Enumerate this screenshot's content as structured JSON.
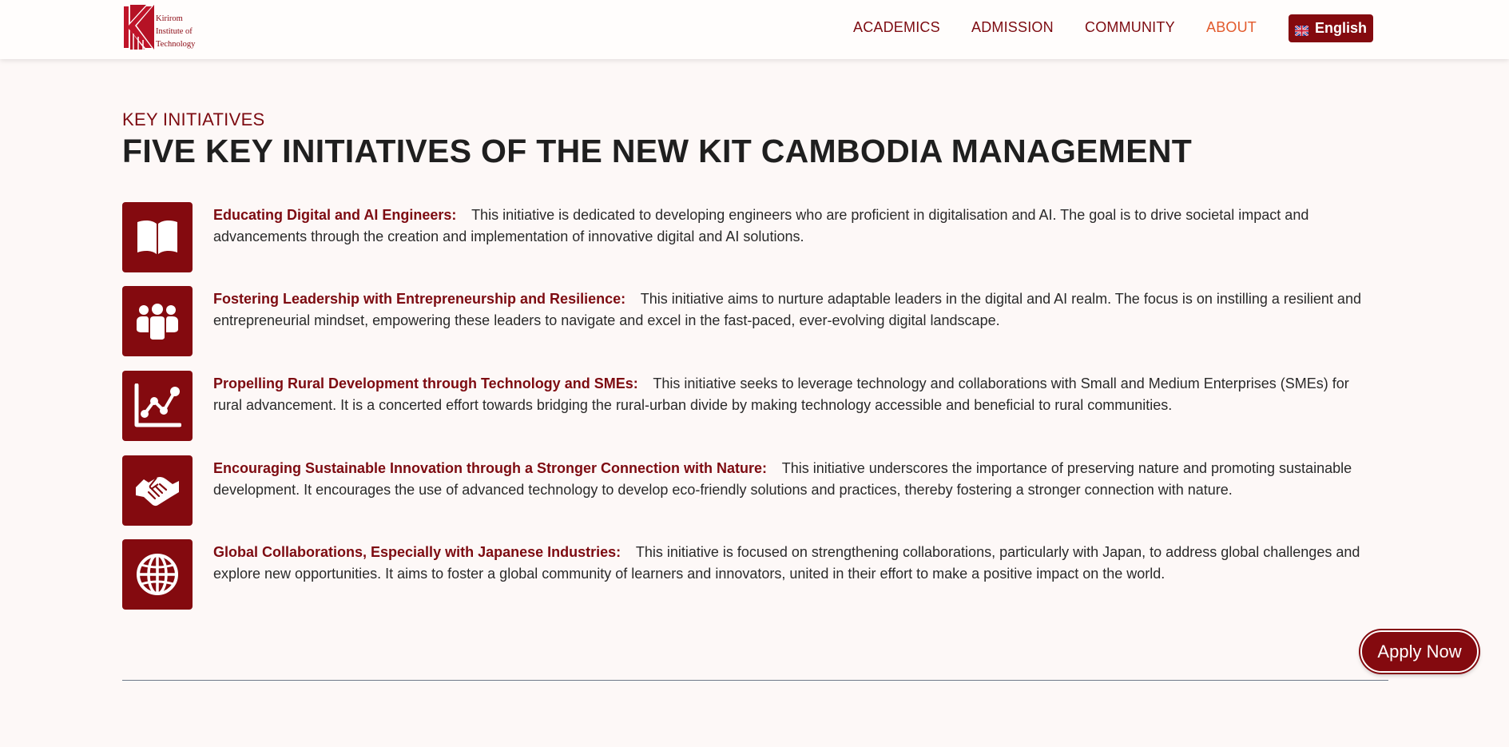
{
  "header": {
    "logo_text_lines": [
      "Kirirom",
      "Institute of",
      "Technology"
    ],
    "nav": [
      {
        "label": "ACADEMICS",
        "active": false
      },
      {
        "label": "ADMISSION",
        "active": false
      },
      {
        "label": "COMMUNITY",
        "active": false
      },
      {
        "label": "ABOUT",
        "active": true
      }
    ],
    "language_button": "English",
    "language_icon": "uk-flag-icon"
  },
  "section": {
    "kicker": "KEY INITIATIVES",
    "title": "FIVE KEY INITIATIVES OF THE NEW KIT CAMBODIA MANAGEMENT"
  },
  "initiatives": [
    {
      "icon": "book-icon",
      "title": "Educating Digital and AI Engineers:",
      "text": "This initiative is dedicated to developing engineers who are proficient in digitalisation and AI. The goal is to drive societal impact and advancements through the creation and implementation of innovative digital and AI solutions."
    },
    {
      "icon": "group-icon",
      "title": "Fostering Leadership with Entrepreneurship and Resilience:",
      "text": "This initiative aims to nurture adaptable leaders in the digital and AI realm. The focus is on instilling a resilient and entrepreneurial mindset, empowering these leaders to navigate and excel in the fast-paced, ever-evolving digital landscape."
    },
    {
      "icon": "line-chart-icon",
      "title": "Propelling Rural Development through Technology and SMEs:",
      "text": "This initiative seeks to leverage technology and collaborations with Small and Medium Enterprises (SMEs) for rural advancement. It is a concerted effort towards bridging the rural-urban divide by making technology accessible and beneficial to rural communities."
    },
    {
      "icon": "handshake-icon",
      "title": "Encouraging Sustainable Innovation through a Stronger Connection with Nature:",
      "text": "This initiative underscores the importance of preserving nature and promoting sustainable development. It encourages the use of advanced technology to develop eco-friendly solutions and practices, thereby fostering a stronger connection with nature."
    },
    {
      "icon": "globe-icon",
      "title": "Global Collaborations, Especially with Japanese Industries:",
      "text": "This initiative is focused on strengthening collaborations, particularly with Japan, to address global challenges and explore new opportunities. It aims to foster a global community of learners and innovators, united in their effort to make a positive impact on the world."
    }
  ],
  "apply_button": "Apply Now",
  "colors": {
    "brand": "#840a0f",
    "active_nav": "#e25a2c",
    "background": "#fdf8f7"
  }
}
